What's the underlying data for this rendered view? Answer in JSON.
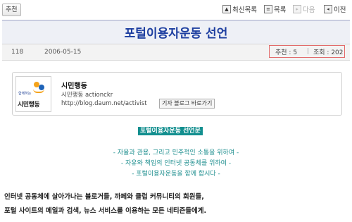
{
  "toolbar": {
    "recommend_label": "추천",
    "latest_list_label": "최신목록",
    "list_label": "목록",
    "next_label": "다음",
    "prev_label": "이전"
  },
  "post": {
    "title": "포털이용자운동 선언",
    "number": "118",
    "date": "2006-05-15",
    "recommend_count_text": "추천 : 5",
    "separator": "|",
    "view_count_text": "조회 : 202"
  },
  "author": {
    "logo_top_text": "함께하는",
    "logo_main_text": "시민행동",
    "name": "시민행동",
    "sub": "시민행동 actionckr",
    "blog_url": "http://blog.daum.net/activist",
    "blog_button_label": "기자 블로그 바로가기"
  },
  "content": {
    "highlight_title": "포털이용자운동 선언문",
    "slogans": [
      "- 자율과 관용, 그리고 민주적인 소통을 위하여 -",
      "- 자유와 책임의 인터넷 공동체를 위하여 -",
      "- 포털이용자운동을 함께 합시다 -"
    ],
    "paragraph_lines": [
      "인터넷 공동체에 살아가나는 블로거들, 까페와 클럽 커뮤니티의 회원들,",
      "포털 사이트의 메일과 검색, 뉴스 서비스를 이용하는 모든 네티즌들에게."
    ]
  },
  "colors": {
    "title_blue": "#1d3ea0",
    "highlight_teal": "#138f8f",
    "slogan_teal": "#1f8f8f",
    "counts_border": "#e26a6a"
  }
}
